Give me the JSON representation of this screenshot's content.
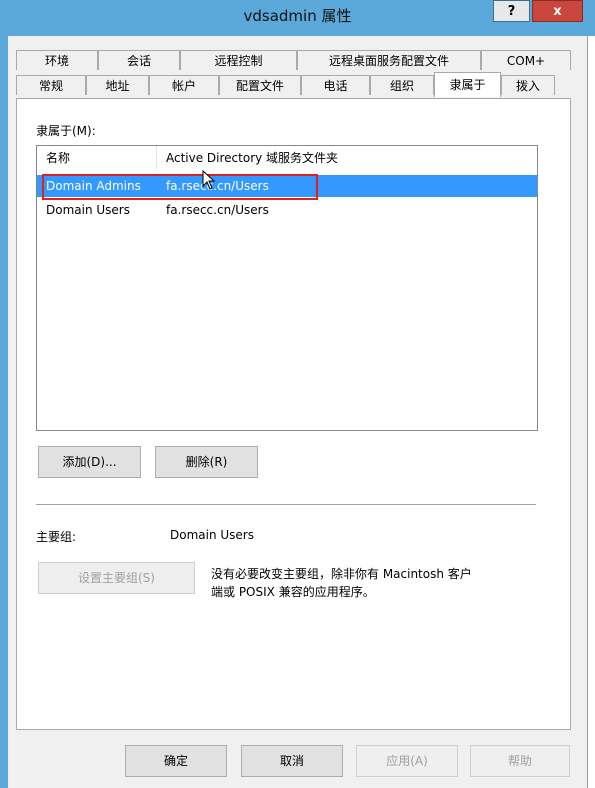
{
  "window": {
    "title": "vdsadmin 属性",
    "help_label": "?",
    "close_label": "x"
  },
  "tabs_row1": [
    "环境",
    "会话",
    "远程控制",
    "远程桌面服务配置文件",
    "COM+"
  ],
  "tabs_row2": [
    "常规",
    "地址",
    "帐户",
    "配置文件",
    "电话",
    "组织",
    "隶属于",
    "拨入"
  ],
  "active_tab": "隶属于",
  "member_of": {
    "label": "隶属于(M):",
    "columns": [
      "名称",
      "Active Directory 域服务文件夹"
    ],
    "rows": [
      {
        "name": "Domain Admins",
        "folder": "fa.rsecc.cn/Users",
        "selected": true
      },
      {
        "name": "Domain Users",
        "folder": "fa.rsecc.cn/Users",
        "selected": false
      }
    ]
  },
  "buttons": {
    "add": "添加(D)...",
    "remove": "删除(R)",
    "set_primary": "设置主要组(S)",
    "ok": "确定",
    "cancel": "取消",
    "apply": "应用(A)",
    "help": "帮助"
  },
  "primary_group": {
    "label": "主要组:",
    "value": "Domain Users",
    "note_line1": "没有必要改变主要组，除非你有 Macintosh 客户",
    "note_line2": "端或 POSIX 兼容的应用程序。"
  },
  "colors": {
    "titlebar": "#5aa9da",
    "selection": "#3399ff",
    "highlight_box": "#e02020",
    "close": "#c9463d"
  }
}
